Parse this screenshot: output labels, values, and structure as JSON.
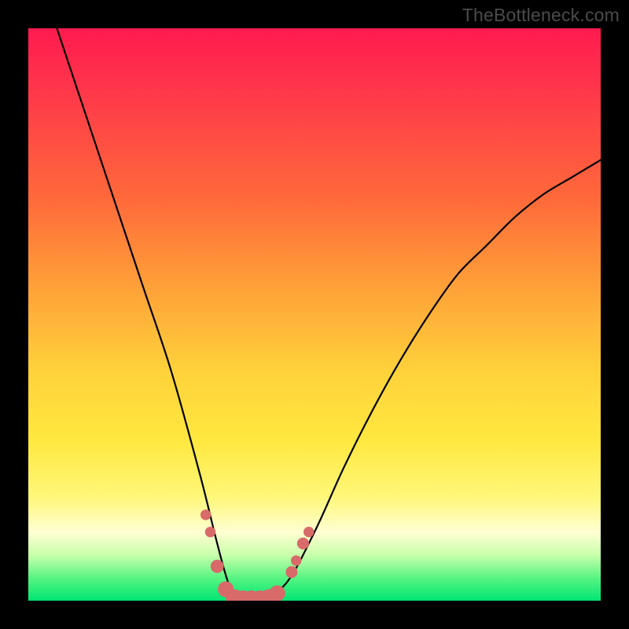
{
  "watermark": "TheBottleneck.com",
  "chart_data": {
    "type": "line",
    "title": "",
    "xlabel": "",
    "ylabel": "",
    "xlim": [
      0,
      100
    ],
    "ylim": [
      0,
      100
    ],
    "series": [
      {
        "name": "bottleneck-curve",
        "x": [
          5,
          10,
          15,
          20,
          25,
          30,
          33,
          35,
          37,
          40,
          45,
          50,
          55,
          60,
          65,
          70,
          75,
          80,
          85,
          90,
          95,
          100
        ],
        "values": [
          100,
          85,
          70,
          55,
          40,
          22,
          10,
          3,
          0,
          0,
          3,
          12,
          23,
          33,
          42,
          50,
          57,
          62,
          67,
          71,
          74,
          77
        ]
      }
    ],
    "markers": {
      "name": "highlight-dots",
      "color": "#d86a6a",
      "points": [
        {
          "x": 31.0,
          "y": 15.0,
          "r": 1.6
        },
        {
          "x": 31.8,
          "y": 12.0,
          "r": 1.6
        },
        {
          "x": 33.0,
          "y": 6.0,
          "r": 2.0
        },
        {
          "x": 34.5,
          "y": 2.0,
          "r": 2.4
        },
        {
          "x": 36.0,
          "y": 0.5,
          "r": 2.6
        },
        {
          "x": 37.5,
          "y": 0.3,
          "r": 2.6
        },
        {
          "x": 39.0,
          "y": 0.3,
          "r": 2.6
        },
        {
          "x": 40.5,
          "y": 0.3,
          "r": 2.6
        },
        {
          "x": 42.0,
          "y": 0.5,
          "r": 2.6
        },
        {
          "x": 43.5,
          "y": 1.3,
          "r": 2.4
        },
        {
          "x": 46.0,
          "y": 5.0,
          "r": 1.8
        },
        {
          "x": 46.8,
          "y": 7.0,
          "r": 1.6
        },
        {
          "x": 48.0,
          "y": 10.0,
          "r": 1.8
        },
        {
          "x": 49.0,
          "y": 12.0,
          "r": 1.6
        }
      ]
    },
    "gradient_stops": [
      {
        "pos": 0,
        "color": "#ff1a4f"
      },
      {
        "pos": 12,
        "color": "#ff3a4a"
      },
      {
        "pos": 30,
        "color": "#ff6a3a"
      },
      {
        "pos": 45,
        "color": "#ffa038"
      },
      {
        "pos": 60,
        "color": "#ffd23a"
      },
      {
        "pos": 72,
        "color": "#ffe83f"
      },
      {
        "pos": 82,
        "color": "#fff77a"
      },
      {
        "pos": 88,
        "color": "#ffffd2"
      },
      {
        "pos": 92,
        "color": "#c9ffab"
      },
      {
        "pos": 96,
        "color": "#58f582"
      },
      {
        "pos": 100,
        "color": "#00e572"
      }
    ]
  }
}
